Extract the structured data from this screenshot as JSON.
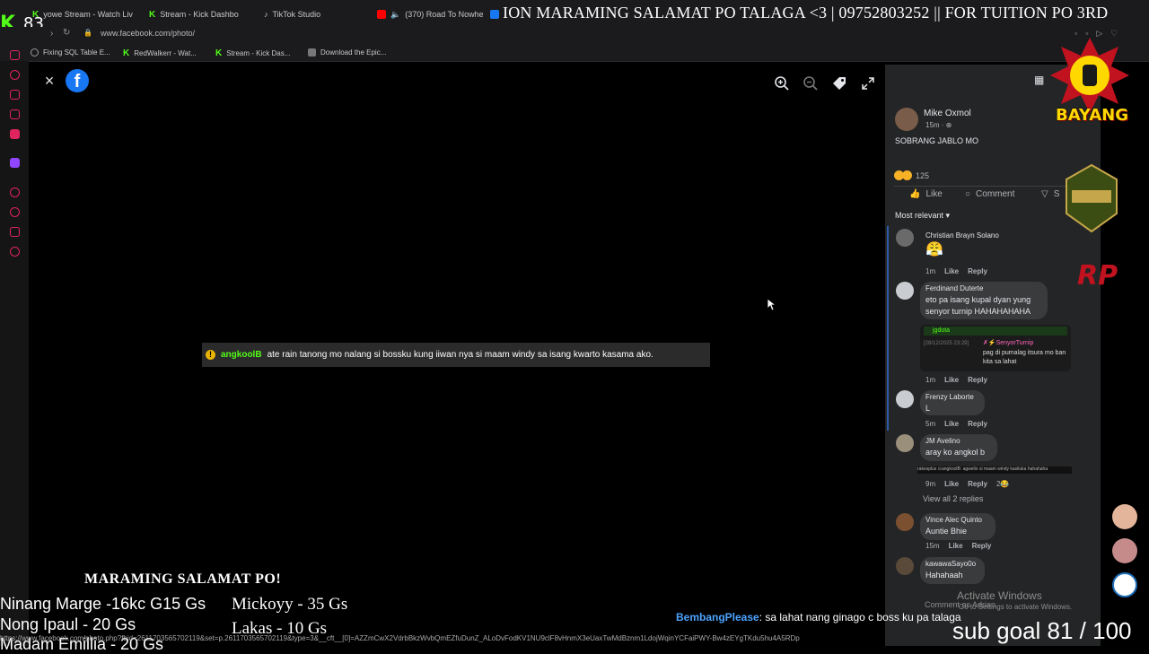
{
  "browser": {
    "tabs": [
      {
        "label": "yowe Stream - Watch Liv",
        "color": "#53fc18"
      },
      {
        "label": "Stream - Kick Dashbo",
        "color": "#53fc18"
      },
      {
        "label": "TikTok Studio",
        "color": "#ffffff"
      },
      {
        "label": "(370) Road To Nowhe",
        "color": "#ff0000"
      }
    ],
    "url": "www.facebook.com/photo/",
    "bookmarks": [
      {
        "label": "Fixing SQL Table E...",
        "color": "#888888"
      },
      {
        "label": "RedWalkerr - Wat...",
        "color": "#53fc18"
      },
      {
        "label": "Stream - Kick Das...",
        "color": "#53fc18"
      },
      {
        "label": "Download the Epic...",
        "color": "#888888"
      }
    ]
  },
  "stream": {
    "kick_logo": "K",
    "viewer_count": "83",
    "ticker": "ION MARAMING SALAMAT PO TALAGA <3  | 09752803252 || FOR TUITION PO 3RD",
    "chat_message": {
      "badge": "!",
      "user": "angkoolB",
      "text": "ate rain tanong mo nalang si bossku kung iiwan nya si maam windy sa isang kwarto kasama ako."
    },
    "bottom_title": "MARAMING SALAMAT PO!",
    "donors_left": [
      "Ninang Marge -16kc G15 Gs",
      "Nong Ipaul - 20 Gs",
      "Madam Emillia - 20 Gs"
    ],
    "donors_right": [
      "Mickoyy - 35 Gs",
      "Lakas - 10 Gs"
    ],
    "bottom_chat": {
      "user": "BembangPlease",
      "text": ": sa lahat nang ginago c boss ku pa talaga"
    },
    "sub_goal": "sub goal 81 / 100",
    "status_url": "https://www.facebook.com/photo.php?fbid=2611703565702119&set=p.2611703565702119&type=3&__cft__[0]=AZZmCwX2VdrbBkzWvbQmEZfuDunZ_ALoDvFodKV1NU9clF8vHnmX3eUaxTwMdBznm1LdojWqinYCFaiPWY-Bw4zEYgTKdu5hu4A5RDp",
    "overlay_logo_text": "BAYANG",
    "overlay_logo2": "RP"
  },
  "photo_viewer": {
    "close_label": "×",
    "brand": "f"
  },
  "post": {
    "author": "Mike Oxmol",
    "time": "15m · ⊕",
    "text": "SOBRANG JABLO MO",
    "reaction_count": "125",
    "actions": {
      "like": "Like",
      "comment": "Comment",
      "share": "S"
    },
    "sort_label": "Most relevant ▾"
  },
  "comments": [
    {
      "name": "Christian Brayn Solano",
      "text": "😤",
      "time": "1m",
      "like": "Like",
      "reply": "Reply"
    },
    {
      "name": "Ferdinand Duterte",
      "text": "eto pa isang kupal dyan yung senyor turnip HAHAHAHAHA",
      "time": "1m",
      "like": "Like",
      "reply": "Reply",
      "gif": {
        "header": "jgdota",
        "time": "[28/12/2025 23:29]",
        "user": "✗⚡SenyorTurnip",
        "text": "pag di pumalag itsura mo ban kita sa lahat"
      }
    },
    {
      "name": "Frenzy Laborte",
      "text": "L",
      "time": "5m",
      "like": "Like",
      "reply": "Reply"
    },
    {
      "name": "JM Avelino",
      "text": "aray ko angkol b",
      "time": "9m",
      "like": "Like",
      "reply": "Reply",
      "reaction": "2😂",
      "strip": "rakesplus ⊙angkoolB: agwelio si maam windy kasiluka hahahaha"
    },
    {
      "name": "Vince Alec Quinto",
      "text": "Auntie Bhie",
      "time": "15m",
      "like": "Like",
      "reply": "Reply"
    },
    {
      "name": "kawawaSayo0o",
      "text": "Hahahaah",
      "time": "",
      "like": "",
      "reply": ""
    }
  ],
  "view_replies": "View all 2 replies",
  "comment_as": "Comment as Adrian",
  "windows": {
    "activate": "Activate Windows",
    "sub": "Go to Settings to activate Windows."
  }
}
